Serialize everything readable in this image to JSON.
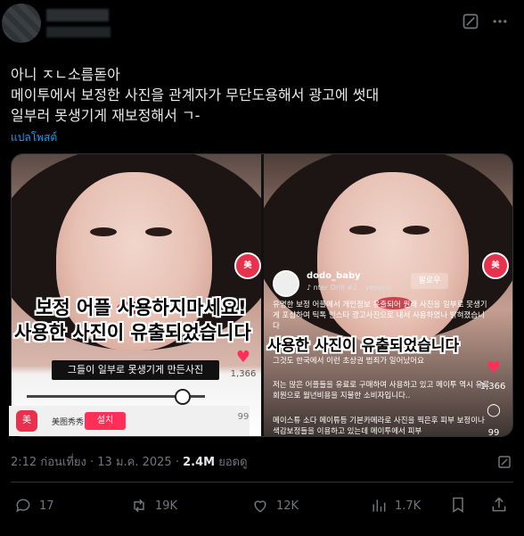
{
  "tweet": {
    "lines": [
      "아니 ㅈㄴ소름돋아",
      "메이투에서 보정한 사진을 관계자가 무단도용해서 광고에 썻대",
      "일부러 못생기게 재보정해서 ㄱ-"
    ],
    "translate_label": "แปลโพสต์"
  },
  "media": {
    "left": {
      "overlay_line1": "보정 어플 사용하지마세요!",
      "overlay_line2": "사용한 사진이 유출되었습니다",
      "caption": "그들이 일부로 못생기게 만든사진",
      "app_name": "美图秀秀",
      "install_label": "설치",
      "like_count": "1,366",
      "comment_count": "99"
    },
    "right": {
      "username": "dodo_baby",
      "music": "nter Drill #2",
      "music_artist": "veneris",
      "follow_label": "팔로우",
      "overlay_line1": "보정어플 사용하지마세요!",
      "overlay_line2": "사용한 사진이 유출되었습니다",
      "desc1": "유명한 보정 어플에서 개인정보 유출되어 원래 사진을 일부로 못생기게 포샵하여 틱톡 인스타 광고사진으로 내서 사용하였나 밝혀졌습니다",
      "desc2": "그것도 한국에서 이런 초상권 범죄가 일어났어요",
      "desc3": "저는 많은 어플들을 유료로 구매하여 사용하고 있고 메이투 역시 유료회원으로 월년비용을 지불한 소비자입니다..",
      "desc4": "메이스튜 소다 메이튜등 기본카메라로 사진을 찍은후 피부 보정이나 색감보정들을 이용하고 있는데 메이투에서 피부",
      "like_count": "1,366",
      "comment_count": "99"
    }
  },
  "meta": {
    "time": "2:12 ก่อนเที่ยง",
    "date": "13 ม.ค. 2025",
    "views": "2.4M",
    "views_label": "ยอดดู"
  },
  "actions": {
    "replies": "17",
    "reposts": "19K",
    "likes": "12K",
    "views": "1.7K"
  }
}
